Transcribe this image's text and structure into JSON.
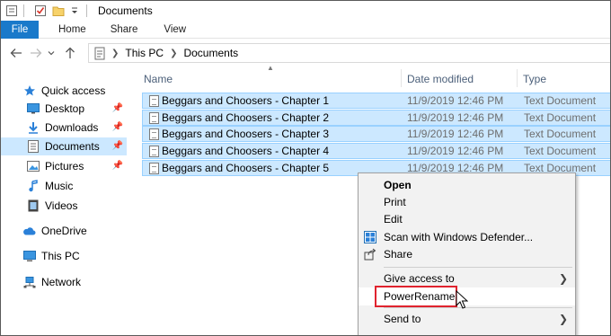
{
  "window": {
    "title": "Documents"
  },
  "ribbon": {
    "tabs": [
      "File",
      "Home",
      "Share",
      "View"
    ]
  },
  "address": {
    "crumbs": [
      "This PC",
      "Documents"
    ]
  },
  "sidebar": {
    "items": [
      {
        "label": "Quick access",
        "icon": "star-icon"
      },
      {
        "label": "Desktop",
        "icon": "desktop-folder-icon",
        "pinned": true
      },
      {
        "label": "Downloads",
        "icon": "download-folder-icon",
        "pinned": true
      },
      {
        "label": "Documents",
        "icon": "documents-folder-icon",
        "pinned": true,
        "selected": true
      },
      {
        "label": "Pictures",
        "icon": "pictures-folder-icon",
        "pinned": true
      },
      {
        "label": "Music",
        "icon": "music-icon"
      },
      {
        "label": "Videos",
        "icon": "videos-icon"
      },
      {
        "label": "OneDrive",
        "icon": "cloud-icon"
      },
      {
        "label": "This PC",
        "icon": "computer-icon"
      },
      {
        "label": "Network",
        "icon": "network-icon"
      }
    ]
  },
  "files": {
    "columns": [
      "Name",
      "Date modified",
      "Type"
    ],
    "rows": [
      {
        "name": "Beggars and Choosers - Chapter 1",
        "date": "11/9/2019 12:46 PM",
        "type": "Text Document"
      },
      {
        "name": "Beggars and Choosers - Chapter 2",
        "date": "11/9/2019 12:46 PM",
        "type": "Text Document"
      },
      {
        "name": "Beggars and Choosers - Chapter 3",
        "date": "11/9/2019 12:46 PM",
        "type": "Text Document"
      },
      {
        "name": "Beggars and Choosers - Chapter 4",
        "date": "11/9/2019 12:46 PM",
        "type": "Text Document"
      },
      {
        "name": "Beggars and Choosers - Chapter 5",
        "date": "11/9/2019 12:46 PM",
        "type": "Text Document"
      }
    ]
  },
  "context_menu": {
    "items": [
      {
        "label": "Open",
        "bold": true
      },
      {
        "label": "Print"
      },
      {
        "label": "Edit"
      },
      {
        "label": "Scan with Windows Defender...",
        "icon": "defender-icon"
      },
      {
        "label": "Share",
        "icon": "share-icon"
      },
      {
        "label": "Give access to",
        "submenu": true
      },
      {
        "label": "PowerRename",
        "highlighted": true
      },
      {
        "label": "Send to",
        "submenu": true
      }
    ]
  },
  "colors": {
    "selection": "#cce8ff",
    "selection_border": "#99d1ff",
    "file_tab": "#1979ca",
    "highlight": "#e0232e"
  }
}
